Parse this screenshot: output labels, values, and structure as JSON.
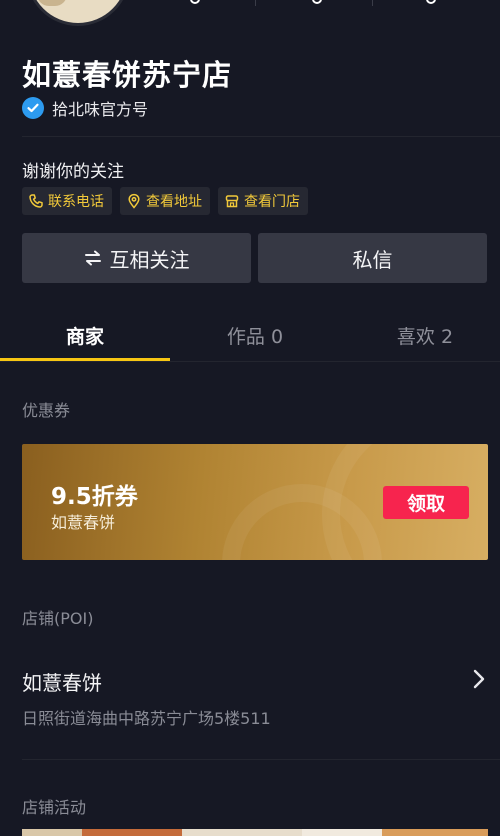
{
  "profile": {
    "title": "如薏春饼苏宁店",
    "verified_label": "拾北味官方号",
    "bio": "谢谢你的关注"
  },
  "chips": [
    {
      "icon": "phone-icon",
      "label": "联系电话"
    },
    {
      "icon": "location-pin-icon",
      "label": "查看地址"
    },
    {
      "icon": "store-icon",
      "label": "查看门店"
    }
  ],
  "actions": {
    "follow_label": "互相关注",
    "message_label": "私信"
  },
  "tabs": [
    {
      "label": "商家",
      "active": true
    },
    {
      "label": "作品 0",
      "active": false
    },
    {
      "label": "喜欢 2",
      "active": false
    }
  ],
  "coupon_section": {
    "label": "优惠券",
    "amount": "9.5折券",
    "shop": "如薏春饼",
    "claim_label": "领取"
  },
  "store_section": {
    "label": "店铺(POI)",
    "name": "如薏春饼",
    "address": "日照街道海曲中路苏宁广场5楼511"
  },
  "activity_section": {
    "label": "店铺活动"
  },
  "colors": {
    "background": "#161824",
    "accent": "#f7c613",
    "chip_text": "#f1c93a",
    "claim_button": "#f7244e",
    "verified": "#2d9bf0"
  }
}
